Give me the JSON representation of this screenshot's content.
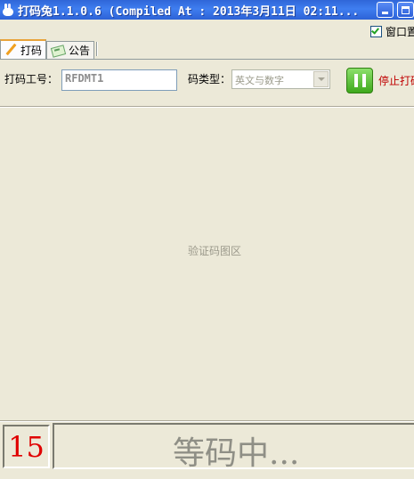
{
  "window": {
    "title": "打码兔1.1.0.6 (Compiled At : 2013年3月11日 02:11...",
    "icon": "rabbit-icon",
    "accent": "#3f7ef0"
  },
  "options": {
    "always_on_top_label": "窗口置",
    "always_on_top_checked": true
  },
  "tabs": [
    {
      "label": "打码",
      "icon": "pencil-icon",
      "active": true
    },
    {
      "label": "公告",
      "icon": "bulletin-icon",
      "active": false
    }
  ],
  "form": {
    "worker_id_label": "打码工号：",
    "worker_id_value": "RFDMT1",
    "code_type_label": "码类型：",
    "code_type_value": "英文与数字",
    "stop_label": "停止打码"
  },
  "captcha_area": {
    "placeholder": "验证码图区"
  },
  "status": {
    "countdown": "15",
    "message": "等码中...",
    "countdown_color": "#e00000"
  }
}
